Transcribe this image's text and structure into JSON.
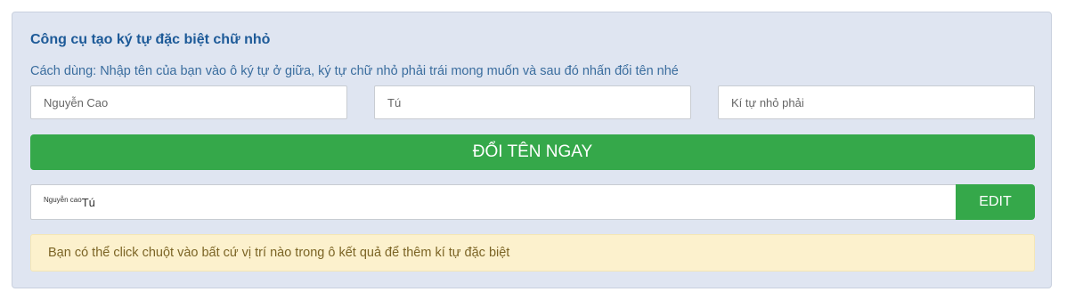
{
  "tool": {
    "title": "Công cụ tạo ký tự đặc biệt chữ nhỏ",
    "usage": "Cách dùng: Nhập tên của bạn vào ô ký tự ở giữa, ký tự chữ nhỏ phải trái mong muốn và sau đó nhấn đổi tên nhé"
  },
  "inputs": {
    "left_placeholder": "Nguyễn Cao",
    "middle_placeholder": "Tú",
    "right_placeholder": "Kí tự nhỏ phải"
  },
  "buttons": {
    "convert_label": "ĐỔI TÊN NGAY",
    "edit_label": "EDIT"
  },
  "result": {
    "small_text": "Nguyễn cao",
    "main_text": "Tú"
  },
  "notice": {
    "text": "Bạn có thể click chuột vào bất cứ vị trí nào trong ô kết quả để thêm kí tự đặc biệt"
  },
  "colors": {
    "panel_bg": "#dfe5f1",
    "title": "#1d5a98",
    "accent_green": "#35a84a",
    "notice_bg": "#fcf1cd",
    "notice_text": "#7b6425"
  }
}
